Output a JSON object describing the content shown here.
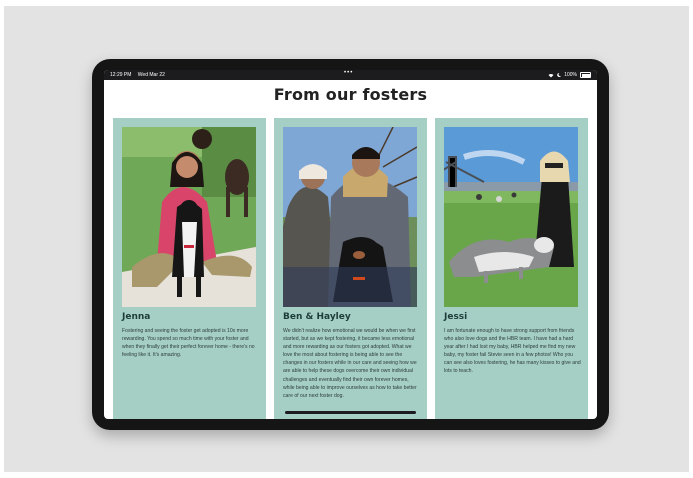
{
  "status_bar": {
    "time": "12:29 PM",
    "date": "Wed Mar 22",
    "battery": "100%"
  },
  "page": {
    "heading": "From our fosters"
  },
  "cards": [
    {
      "name": "Jenna",
      "text": "Fostering and seeing the foster get adopted is 10x more rewarding. You spend so much time with your foster and when they finally get their perfect forever home - there's no feeling like it. It's amazing."
    },
    {
      "name": "Ben & Hayley",
      "text": "We didn't realize how emotional we would be when we first started, but as we kept fostering, it became less emotional and more rewarding as our fosters got adopted. What we love the most about fostering is being able to see the changes in our fosters while in our care and seeing how we are able to help these dogs overcome their own individual challenges and eventually find their own forever homes, while being able to improve ourselves as how to take better care of our next foster dog."
    },
    {
      "name": "Jessi",
      "text": "I am fortunate enough to have strong support from friends who also love dogs and the HBR team. I have had a hard year after I had lost my baby, HBR helped me find my new baby, my foster fail Stevie seen in a few photos! Who you can see also loves fostering, he has many kisses to give and lots to teach."
    }
  ],
  "colors": {
    "card_bg": "#a5cfc4",
    "heading": "#222222",
    "device": "#151516"
  }
}
